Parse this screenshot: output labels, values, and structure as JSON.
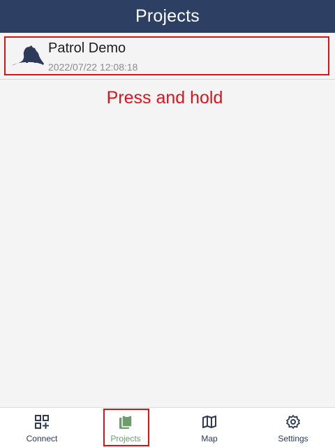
{
  "header": {
    "title": "Projects"
  },
  "projects": [
    {
      "name": "Patrol Demo",
      "date": "2022/07/22 12:08:18",
      "logo_icon": "panther-logo-icon"
    }
  ],
  "annotation": {
    "text": "Press and hold",
    "color": "#e0121a"
  },
  "tabs": [
    {
      "label": "Connect",
      "icon": "qr-add-icon",
      "active": false
    },
    {
      "label": "Projects",
      "icon": "clipboard-icon",
      "active": true
    },
    {
      "label": "Map",
      "icon": "map-icon",
      "active": false
    },
    {
      "label": "Settings",
      "icon": "gear-icon",
      "active": false
    }
  ],
  "colors": {
    "header_bg": "#2d4064",
    "accent_active": "#6b9e6b",
    "highlight": "#d3161c"
  }
}
